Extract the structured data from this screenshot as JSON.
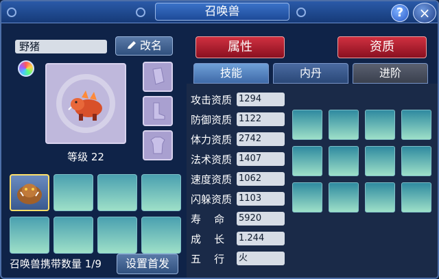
{
  "window": {
    "title": "召唤兽"
  },
  "header": {
    "help_label": "?",
    "close_label": "×"
  },
  "pet": {
    "name": "野猪",
    "level_text": "等级 22"
  },
  "buttons": {
    "rename": "改名",
    "set_leader": "设置首发"
  },
  "top_tabs": {
    "attributes": "属性",
    "aptitude": "资质"
  },
  "sub_tabs": [
    {
      "label": "技能"
    },
    {
      "label": "内丹"
    },
    {
      "label": "进阶"
    }
  ],
  "stats": [
    {
      "label": "攻击资质",
      "value": "1294"
    },
    {
      "label": "防御资质",
      "value": "1122"
    },
    {
      "label": "体力资质",
      "value": "2742"
    },
    {
      "label": "法术资质",
      "value": "1407"
    },
    {
      "label": "速度资质",
      "value": "1062"
    },
    {
      "label": "闪躲资质",
      "value": "1103"
    },
    {
      "label": "寿    命",
      "value": "5920"
    },
    {
      "label": "成    长",
      "value": "1.244"
    },
    {
      "label": "五    行",
      "value": "火"
    }
  ],
  "footer": {
    "carry_count": "召唤兽携带数量 1/9"
  },
  "icons": {
    "rename": "pencil-icon",
    "orb": "rainbow-orb-icon",
    "portrait": "boar-icon",
    "equip": [
      "armguard-icon",
      "boots-icon",
      "armor-icon"
    ]
  },
  "colors": {
    "primary_tab": "#d03040",
    "active_slot_border": "#ffe16a",
    "slot_fill": "#9ee0c8"
  }
}
